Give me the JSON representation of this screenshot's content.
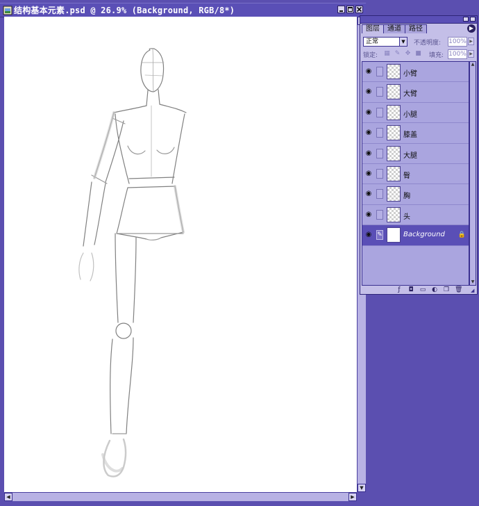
{
  "window": {
    "title": "结构基本元素.psd @ 26.9% (Background, RGB/8*)"
  },
  "palette": {
    "tabs": [
      {
        "label": "图层"
      },
      {
        "label": "通道"
      },
      {
        "label": "路径"
      }
    ],
    "blend_mode": "正常",
    "opacity_label": "不透明度:",
    "opacity_value": "100%",
    "lock_label": "锁定:",
    "fill_label": "填充:",
    "fill_value": "100%",
    "layers": [
      {
        "name": "小臂",
        "selected": false
      },
      {
        "name": "大臂",
        "selected": false
      },
      {
        "name": "小腿",
        "selected": false
      },
      {
        "name": "膝盖",
        "selected": false
      },
      {
        "name": "大腿",
        "selected": false
      },
      {
        "name": "臀",
        "selected": false
      },
      {
        "name": "胸",
        "selected": false
      },
      {
        "name": "头",
        "selected": false
      },
      {
        "name": "Background",
        "selected": true
      }
    ],
    "bottom_icons": [
      "link-icon",
      "layer-style-icon",
      "mask-icon",
      "new-set-icon",
      "adjustment-layer-icon",
      "new-layer-icon",
      "trash-icon"
    ]
  },
  "colors": {
    "workspace": "#5b4fb0",
    "panel": "#c4bfe8",
    "selected_row": "#5a4fb6"
  }
}
